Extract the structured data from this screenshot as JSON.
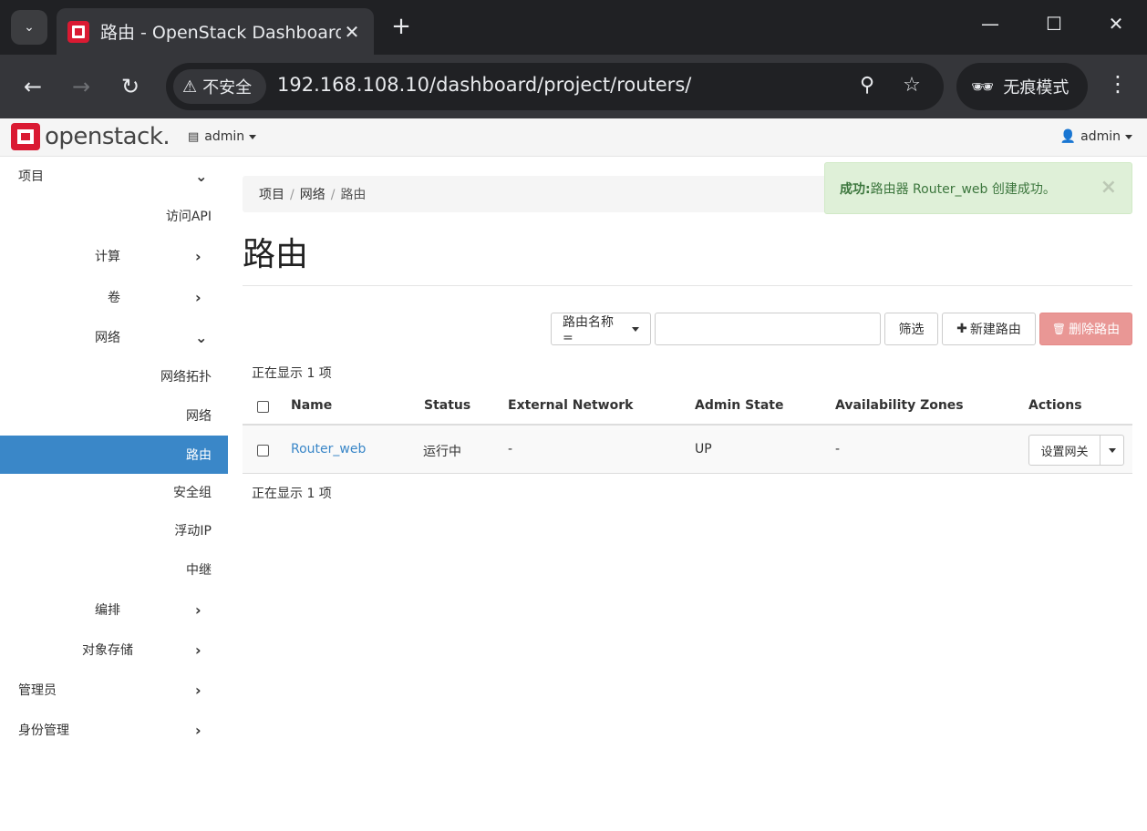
{
  "browser": {
    "tab_title": "路由 - OpenStack Dashboard",
    "security_label": "不安全",
    "url": "192.168.108.10/dashboard/project/routers/",
    "incognito_label": "无痕模式"
  },
  "topnav": {
    "logo_text": "openstack.",
    "project_label": "admin",
    "user_label": "admin"
  },
  "sidebar": {
    "project": "项目",
    "access_api": "访问API",
    "compute": "计算",
    "volumes": "卷",
    "network": "网络",
    "network_topology": "网络拓扑",
    "networks": "网络",
    "routers": "路由",
    "security_groups": "安全组",
    "floating_ips": "浮动IP",
    "trunks": "中继",
    "orchestration": "编排",
    "object_store": "对象存储",
    "admin": "管理员",
    "identity": "身份管理"
  },
  "breadcrumb": [
    "项目",
    "网络",
    "路由"
  ],
  "page_title": "路由",
  "alert": {
    "strong": "成功:",
    "message": "路由器 Router_web 创建成功。"
  },
  "filter": {
    "field_label": "路由名称 =",
    "input_value": "",
    "filter_button": "筛选",
    "create_button": "新建路由",
    "delete_button": "删除路由"
  },
  "count_top": "正在显示 1 项",
  "count_bottom": "正在显示 1 项",
  "table": {
    "headers": [
      "Name",
      "Status",
      "External Network",
      "Admin State",
      "Availability Zones",
      "Actions"
    ],
    "rows": [
      {
        "name": "Router_web",
        "status": "运行中",
        "external_network": "-",
        "admin_state": "UP",
        "availability_zones": "-",
        "action": "设置网关"
      }
    ]
  }
}
